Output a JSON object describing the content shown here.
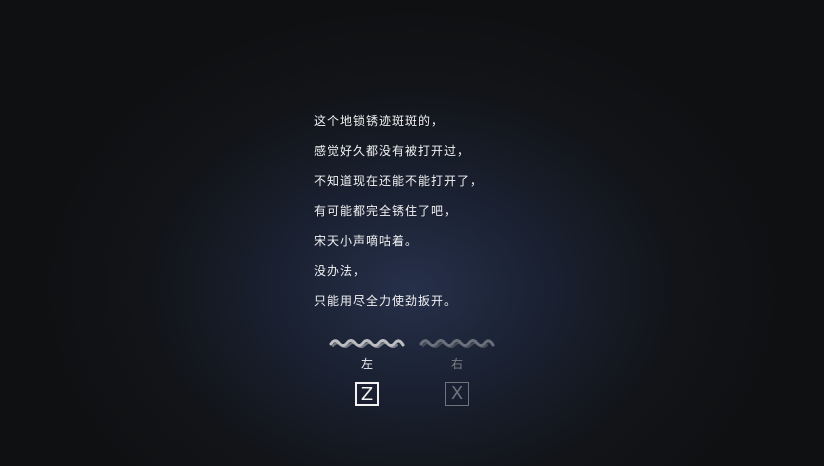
{
  "narrative": {
    "lines": [
      "这个地锁锈迹斑斑的，",
      "感觉好久都没有被打开过，",
      "不知道现在还能不能打开了，",
      "有可能都完全锈住了吧，",
      "宋天小声嘀咕着。",
      "没办法，",
      "只能用尽全力使劲扳开。"
    ]
  },
  "choices": {
    "left": {
      "label": "左",
      "key": "Z",
      "icon": "squiggle-decoration-icon",
      "color": "#f2f2f2"
    },
    "right": {
      "label": "右",
      "key": "X",
      "icon": "squiggle-decoration-icon",
      "color": "#6e737c"
    }
  }
}
